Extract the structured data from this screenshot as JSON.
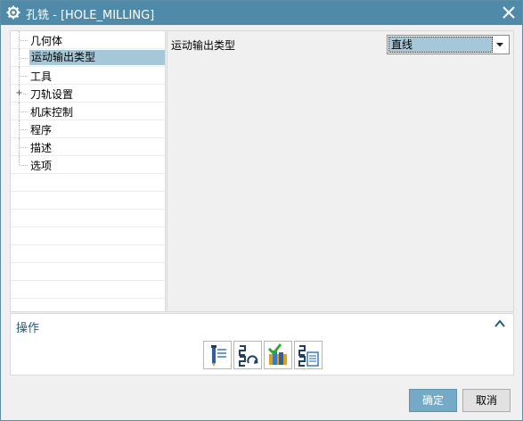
{
  "window": {
    "title": "孔铣 - [HOLE_MILLING]"
  },
  "tree": {
    "items": [
      {
        "label": "几何体",
        "selected": false,
        "expandable": false
      },
      {
        "label": "运动输出类型",
        "selected": true,
        "expandable": false
      },
      {
        "label": "工具",
        "selected": false,
        "expandable": false
      },
      {
        "label": "刀轨设置",
        "selected": false,
        "expandable": true
      },
      {
        "label": "机床控制",
        "selected": false,
        "expandable": false
      },
      {
        "label": "程序",
        "selected": false,
        "expandable": false
      },
      {
        "label": "描述",
        "selected": false,
        "expandable": false
      },
      {
        "label": "选项",
        "selected": false,
        "expandable": false
      }
    ],
    "expander_symbol": "+"
  },
  "panel": {
    "field_label": "运动输出类型",
    "combo_value": "直线"
  },
  "operations": {
    "title": "操作",
    "icons": [
      "generate-toolpath-icon",
      "replay-toolpath-icon",
      "verify-toolpath-icon",
      "list-toolpath-icon"
    ]
  },
  "footer": {
    "ok_label": "确定",
    "cancel_label": "取消"
  },
  "colors": {
    "titlebar": "#4f8aa8",
    "selection": "#a6c7d8",
    "ok_button": "#74aac6",
    "ops_title": "#1c5c7c"
  }
}
